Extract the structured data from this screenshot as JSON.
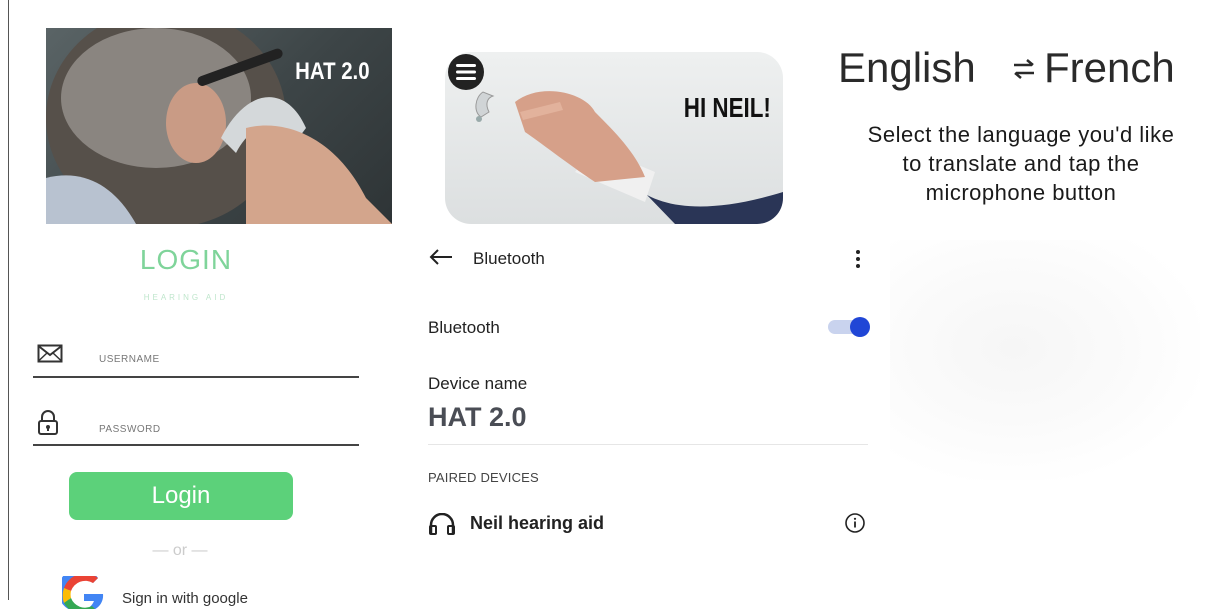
{
  "login": {
    "banner_text": "HAT 2.0",
    "title": "LOGIN",
    "subtitle": "HEARING AID",
    "username_label": "USERNAME",
    "password_label": "PASSWORD",
    "login_button": "Login",
    "or_text": "— or —",
    "google_button": "Sign in with google"
  },
  "bluetooth": {
    "banner_text": "HI NEIL!",
    "header_title": "Bluetooth",
    "toggle_label": "Bluetooth",
    "toggle_on": true,
    "device_name_label": "Device name",
    "device_name_value": "HAT 2.0",
    "paired_section_label": "PAIRED DEVICES",
    "paired_devices": [
      {
        "name": "Neil hearing aid"
      }
    ]
  },
  "translate": {
    "source_language": "English",
    "target_language": "French",
    "instructions": "Select the language you'd like to translate and tap the microphone button"
  },
  "colors": {
    "login_green": "#5cd17a",
    "title_green": "#7fd49a",
    "toggle_blue": "#2046d6"
  },
  "icons": [
    "mail-icon",
    "lock-icon",
    "google-icon",
    "menu-icon",
    "back-arrow-icon",
    "more-vert-icon",
    "headphones-icon",
    "info-icon",
    "swap-icon"
  ]
}
